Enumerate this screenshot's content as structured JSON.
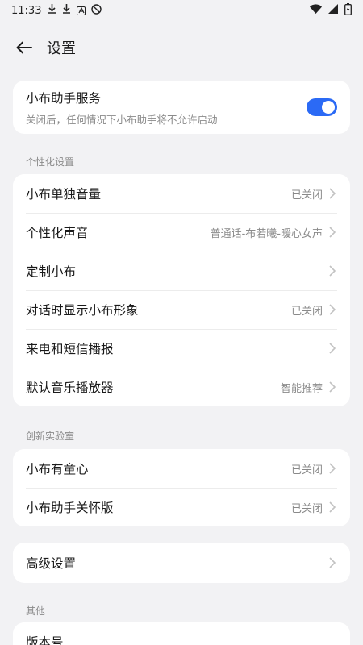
{
  "status": {
    "time": "11:33"
  },
  "header": {
    "title": "设置"
  },
  "service": {
    "title": "小布助手服务",
    "desc": "关闭后，任何情况下小布助手将不允许启动",
    "enabled": true
  },
  "personal": {
    "section": "个性化设置",
    "items": [
      {
        "label": "小布单独音量",
        "value": "已关闭"
      },
      {
        "label": "个性化声音",
        "value": "普通话-布若曦-暖心女声"
      },
      {
        "label": "定制小布",
        "value": ""
      },
      {
        "label": "对话时显示小布形象",
        "value": "已关闭"
      },
      {
        "label": "来电和短信播报",
        "value": ""
      },
      {
        "label": "默认音乐播放器",
        "value": "智能推荐"
      }
    ]
  },
  "lab": {
    "section": "创新实验室",
    "items": [
      {
        "label": "小布有童心",
        "value": "已关闭"
      },
      {
        "label": "小布助手关怀版",
        "value": "已关闭"
      }
    ]
  },
  "advanced": {
    "label": "高级设置"
  },
  "other": {
    "section": "其他",
    "items": [
      {
        "label": "版本号"
      }
    ]
  }
}
